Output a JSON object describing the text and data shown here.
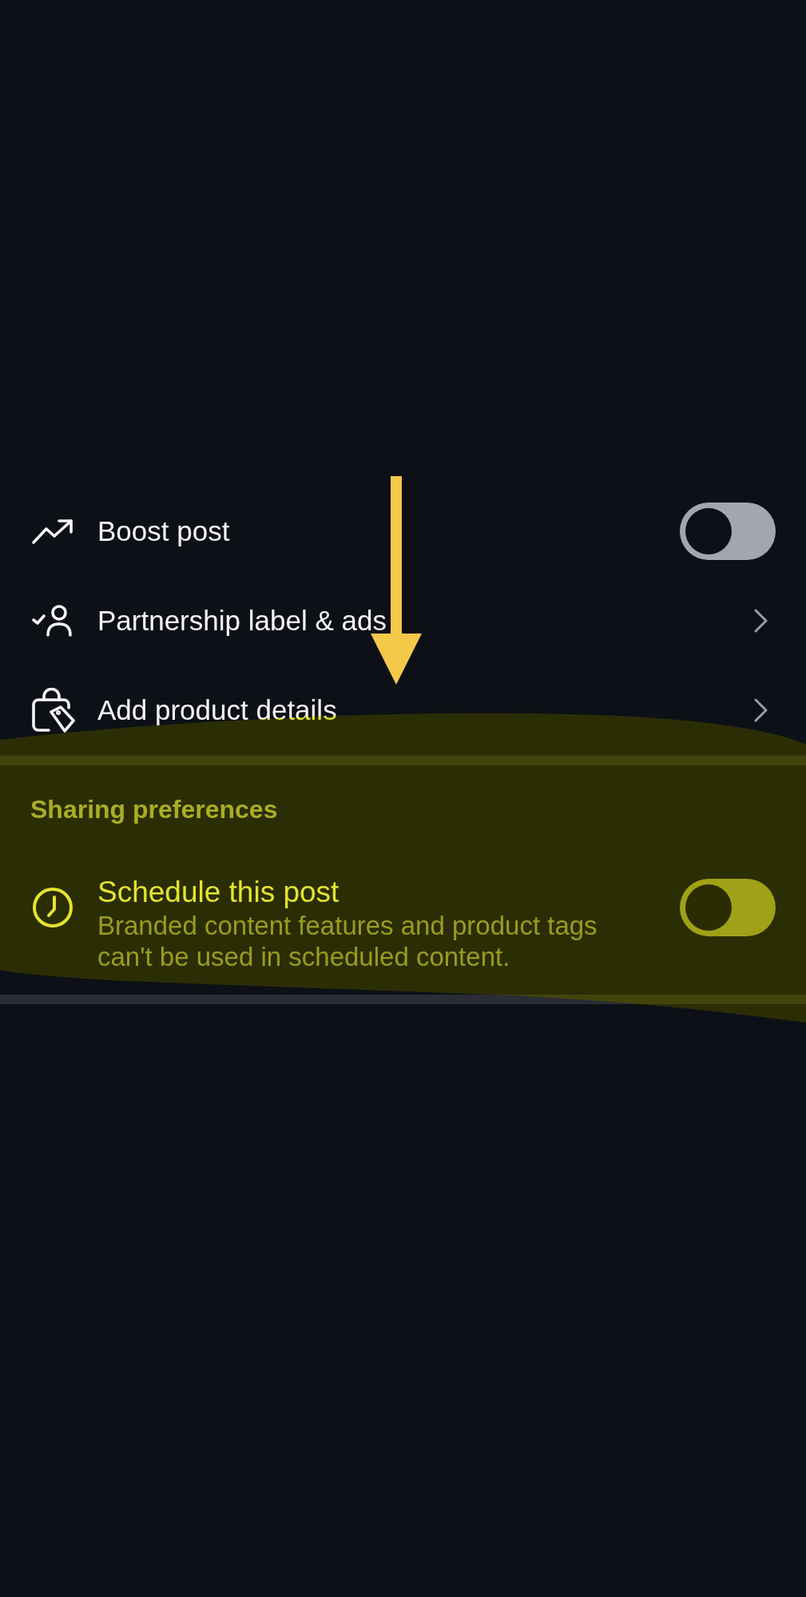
{
  "settings": [
    {
      "kind": "toggle",
      "label": "Boost post",
      "on": false
    },
    {
      "kind": "link",
      "label": "Partnership label & ads"
    },
    {
      "kind": "link",
      "label": "Add product details"
    }
  ],
  "sections": [
    {
      "title": "Sharing preferences",
      "items": [
        {
          "kind": "toggle",
          "label": "Schedule this post",
          "description": "Branded content features and product tags can't be used in scheduled content.",
          "on": false
        }
      ]
    }
  ],
  "annotations": {
    "arrow": true,
    "highlight": true
  }
}
